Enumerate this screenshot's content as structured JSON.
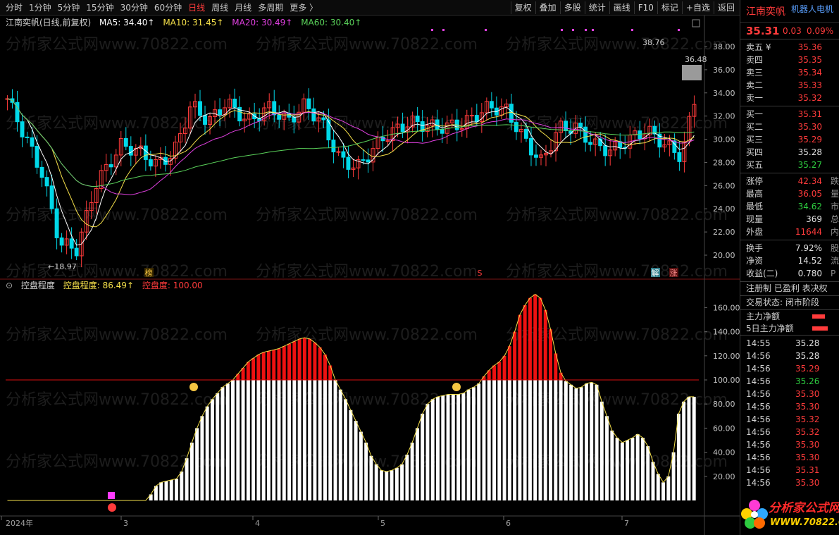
{
  "toolbar": {
    "periods": [
      "分时",
      "1分钟",
      "5分钟",
      "15分钟",
      "30分钟",
      "60分钟",
      "日线",
      "周线",
      "月线",
      "多周期",
      "更多 〉"
    ],
    "active_period": "日线",
    "buttons": [
      "复权",
      "叠加",
      "多股",
      "统计",
      "画线",
      "F10",
      "标记",
      "+自选",
      "返回"
    ]
  },
  "main_legend": {
    "stock": "江南奕帆(日线,前复权)",
    "ma5": "MA5: 34.40↑",
    "ma10": "MA10: 31.45↑",
    "ma20": "MA20: 30.49↑",
    "ma60": "MA60: 30.40↑"
  },
  "sub_legend": {
    "name": "控盘程度",
    "v1": "控盘程度: 86.49↑",
    "v2": "控盘度: 100.00"
  },
  "price_axis": [
    "38.00",
    "36.00",
    "34.00",
    "32.00",
    "30.00",
    "28.00",
    "26.00",
    "24.00",
    "22.00",
    "20.00"
  ],
  "sub_axis": [
    "160.00",
    "140.00",
    "120.00",
    "100.00",
    "80.00",
    "60.00",
    "40.00",
    "20.00"
  ],
  "annotations": {
    "low": "←18.97",
    "high": "38.76",
    "box_price": "36.48",
    "mark_bang": "榜",
    "mark_s": "S",
    "mark_jie": "解",
    "mark_zhang": "涨"
  },
  "x_labels": [
    "2024年",
    "3",
    "4",
    "5",
    "6",
    "7"
  ],
  "watermark": "分析家公式网www.70822.com",
  "chart_data": {
    "type": "bar",
    "series": [
      {
        "name": "控盘程度",
        "values": [
          0,
          0,
          0,
          0,
          0,
          0,
          0,
          0,
          0,
          0,
          0,
          0,
          0,
          0,
          0,
          0,
          0,
          0,
          0,
          0,
          0,
          0,
          0,
          0,
          0,
          0,
          0,
          0,
          5,
          12,
          15,
          16,
          17,
          18,
          24,
          35,
          48,
          60,
          70,
          78,
          84,
          89,
          94,
          97,
          100,
          105,
          110,
          115,
          118,
          121,
          123,
          124,
          125,
          126,
          128,
          130,
          132,
          134,
          135,
          134,
          131,
          127,
          121,
          112,
          100,
          92,
          84,
          75,
          66,
          57,
          48,
          37,
          30,
          25,
          24,
          25,
          27,
          30,
          38,
          48,
          60,
          72,
          80,
          84,
          86,
          87,
          88,
          88,
          88,
          89,
          92,
          94,
          97,
          103,
          108,
          112,
          115,
          120,
          128,
          140,
          154,
          162,
          168,
          171,
          168,
          158,
          142,
          122,
          106,
          99,
          96,
          93,
          94,
          97,
          98,
          96,
          82,
          70,
          58,
          52,
          48,
          50,
          52,
          55,
          52,
          45,
          32,
          22,
          15,
          20,
          40,
          72,
          82,
          86,
          86
        ]
      }
    ],
    "ylim": [
      0,
      180
    ],
    "reference_line": 100,
    "price_range": [
      18.97,
      38.76
    ],
    "ma_legend": [
      "MA5",
      "MA10",
      "MA20",
      "MA60"
    ]
  },
  "quote": {
    "name": "江南奕帆",
    "tag": "机器人电机",
    "price": "35.31",
    "change": "0.03",
    "change_pct": "0.09%",
    "asks": [
      {
        "label": "卖五 ¥",
        "price": "35.36",
        "cls": "red"
      },
      {
        "label": "卖四",
        "price": "35.35",
        "cls": "red"
      },
      {
        "label": "卖三",
        "price": "35.34",
        "cls": "red"
      },
      {
        "label": "卖二",
        "price": "35.33",
        "cls": "red"
      },
      {
        "label": "卖一",
        "price": "35.32",
        "cls": "red"
      }
    ],
    "bids": [
      {
        "label": "买一",
        "price": "35.31",
        "cls": "red"
      },
      {
        "label": "买二",
        "price": "35.30",
        "cls": "red"
      },
      {
        "label": "买三",
        "price": "35.29",
        "cls": "red"
      },
      {
        "label": "买四",
        "price": "35.28",
        "cls": "white"
      },
      {
        "label": "买五",
        "price": "35.27",
        "cls": "green"
      }
    ],
    "stats1": [
      {
        "label": "涨停",
        "value": "42.34",
        "cls": "red",
        "x": "跌"
      },
      {
        "label": "最高",
        "value": "36.05",
        "cls": "red",
        "x": "量"
      },
      {
        "label": "最低",
        "value": "34.62",
        "cls": "green",
        "x": "市"
      },
      {
        "label": "现量",
        "value": "369",
        "cls": "white",
        "x": "总"
      },
      {
        "label": "外盘",
        "value": "11644",
        "cls": "red",
        "x": "内"
      }
    ],
    "stats2": [
      {
        "label": "换手",
        "value": "7.92%",
        "cls": "white",
        "x": "股"
      },
      {
        "label": "净资",
        "value": "14.52",
        "cls": "white",
        "x": "流"
      },
      {
        "label": "收益(二)",
        "value": "0.780",
        "cls": "white",
        "x": "P"
      }
    ],
    "tags_line": "注册制 已盈利 表决权",
    "trade_state": "交易状态: 闭市阶段",
    "fund1": "主力净额",
    "fund2": "5日主力净额",
    "trades": [
      {
        "t": "14:55",
        "v": "35.28",
        "cls": "white"
      },
      {
        "t": "14:56",
        "v": "35.28",
        "cls": "white"
      },
      {
        "t": "14:56",
        "v": "35.29",
        "cls": "red"
      },
      {
        "t": "14:56",
        "v": "35.26",
        "cls": "green"
      },
      {
        "t": "14:56",
        "v": "35.30",
        "cls": "red"
      },
      {
        "t": "14:56",
        "v": "35.30",
        "cls": "red"
      },
      {
        "t": "14:56",
        "v": "35.32",
        "cls": "red"
      },
      {
        "t": "14:56",
        "v": "35.32",
        "cls": "red"
      },
      {
        "t": "14:56",
        "v": "35.30",
        "cls": "red"
      },
      {
        "t": "14:56",
        "v": "35.30",
        "cls": "red"
      },
      {
        "t": "14:56",
        "v": "35.31",
        "cls": "red"
      },
      {
        "t": "14:56",
        "v": "35.30",
        "cls": "red"
      }
    ],
    "logo1": "分析家公式网",
    "logo2": "WWW.70822.COM"
  }
}
